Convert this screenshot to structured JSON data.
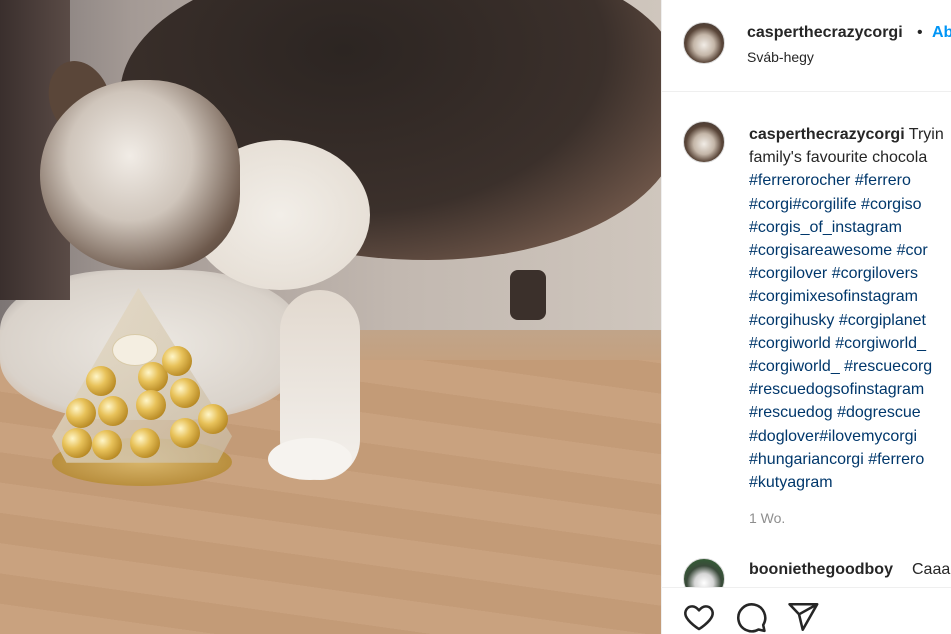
{
  "post": {
    "author": {
      "username": "casperthecrazycorgi",
      "location": "Sváb-hegy",
      "follow_label": "Ab",
      "separator": "•"
    },
    "caption": {
      "username": "casperthecrazycorgi",
      "text_line1": "Tryin",
      "text_line2": "family's favourite chocola",
      "hashtags": [
        "#ferrerorocher #ferrero",
        "#corgi#corgilife #corgiso",
        "#corgis_of_instagram",
        "#corgisareawesome #cor",
        "#corgilover #corgilovers",
        "#corgimixesofinstagram",
        "#corgihusky #corgiplanet",
        "#corgiworld #corgiworld_",
        "#corgiworld_ #rescuecorg",
        "#rescuedogsofinstagram",
        "#rescuedog #dogrescue",
        "#doglover#ilovemycorgi",
        "#hungariancorgi #ferrero",
        "#kutyagram"
      ],
      "time_ago": "1 Wo."
    },
    "comment": {
      "username": "booniethegoodboy",
      "text": "Caaa"
    }
  },
  "actions": {
    "like_icon": "heart-outline-icon",
    "comment_icon": "speech-bubble-icon",
    "share_icon": "paper-plane-icon"
  },
  "colors": {
    "link": "#00376b",
    "follow": "#0095f6",
    "text": "#262626",
    "muted": "#8e8e8e"
  }
}
